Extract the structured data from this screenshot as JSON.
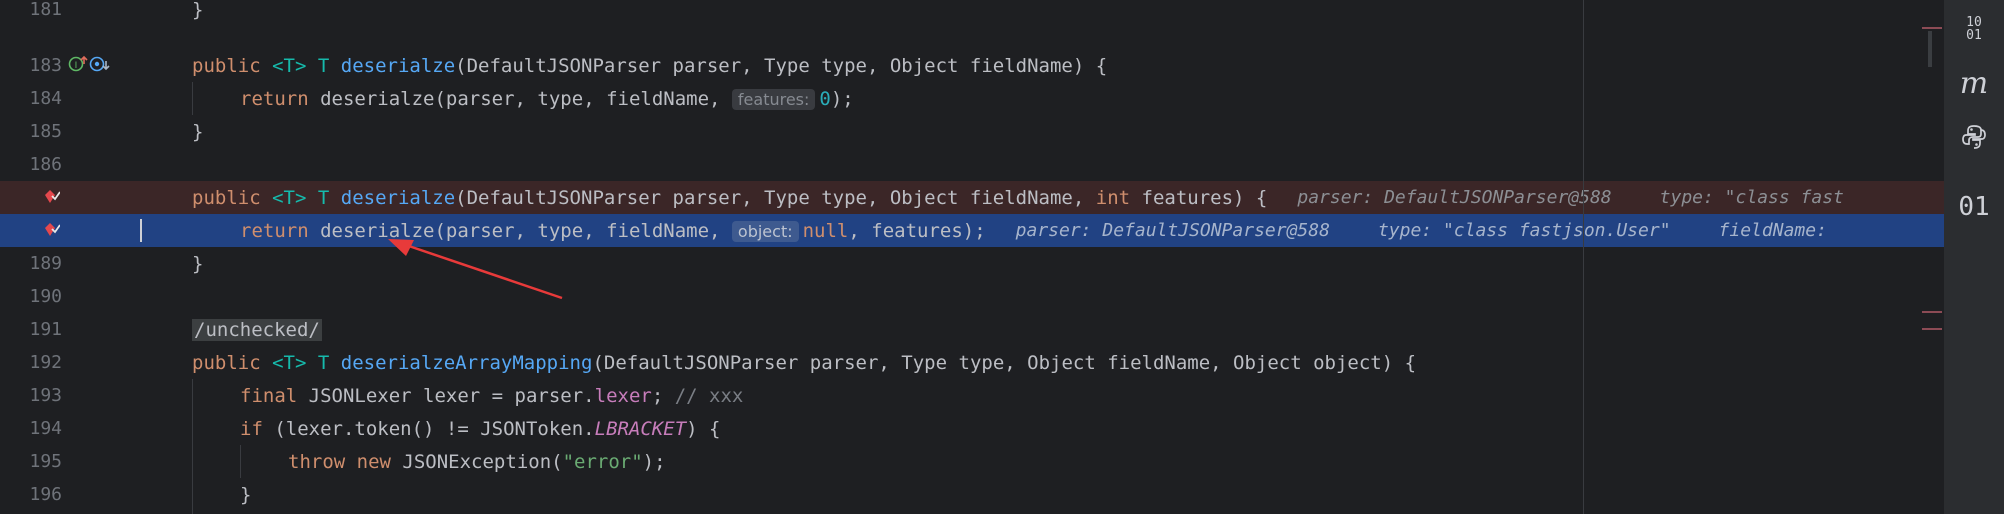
{
  "gutter": {
    "line_numbers": [
      "181",
      "183",
      "184",
      "185",
      "186",
      "",
      "",
      "189",
      "190",
      "191",
      "192",
      "193",
      "194",
      "195",
      "196"
    ]
  },
  "lines": {
    "l181": {
      "brace": "}"
    },
    "l183": {
      "kw_public": "public",
      "generic": "<T>",
      "ret": "T",
      "method": "deserialze",
      "params": "(DefaultJSONParser parser, Type type, Object fieldName) {"
    },
    "l184": {
      "kw_return": "return",
      "call": "deserialze(parser, type, fieldName, ",
      "hint": "features:",
      "num": "0",
      "end": ");"
    },
    "l185": {
      "brace": "}"
    },
    "l187": {
      "kw_public": "public",
      "generic": "<T>",
      "ret": "T",
      "method": "deserialze",
      "params_a": "(DefaultJSONParser parser, Type type, Object fieldName, ",
      "kw_int": "int",
      "params_b": " features) {",
      "dbg1": "parser: DefaultJSONParser@588",
      "dbg2": "type: \"class fast"
    },
    "l188": {
      "kw_return": "return",
      "call": "deserialze(parser, type, fieldName, ",
      "hint": "object:",
      "kw_null": "null",
      "end": ", features);",
      "dbg1": "parser: DefaultJSONParser@588",
      "dbg2": "type: \"class fastjson.User\"",
      "dbg3": "fieldName:"
    },
    "l189": {
      "brace": "}"
    },
    "l191": {
      "annotation": "/unchecked/"
    },
    "l192": {
      "kw_public": "public",
      "generic": "<T>",
      "ret": "T",
      "method": "deserialzeArrayMapping",
      "params": "(DefaultJSONParser parser, Type type, Object fieldName, Object object) {"
    },
    "l193": {
      "kw_final": "final",
      "decl": " JSONLexer lexer = parser.",
      "field": "lexer",
      "semi": "; ",
      "comment": "// xxx"
    },
    "l194": {
      "kw_if": "if",
      "cond": " (lexer.token() != JSONToken.",
      "static": "LBRACKET",
      "end": ") {"
    },
    "l195": {
      "kw_throw": "throw",
      "kw_new": "new",
      "cls": " JSONException(",
      "str": "\"error\"",
      "end": ");"
    },
    "l196": {
      "brace": "}"
    }
  },
  "toolstrip": {
    "binary_top": "10\n01",
    "maven": "m",
    "python": "python-icon",
    "binary": "01"
  },
  "colors": {
    "breakpoint_line": "#3b2627",
    "current_line": "#214283",
    "keyword": "#cf8e6d",
    "method": "#56a8f5",
    "arrow": "#e83a3a"
  }
}
